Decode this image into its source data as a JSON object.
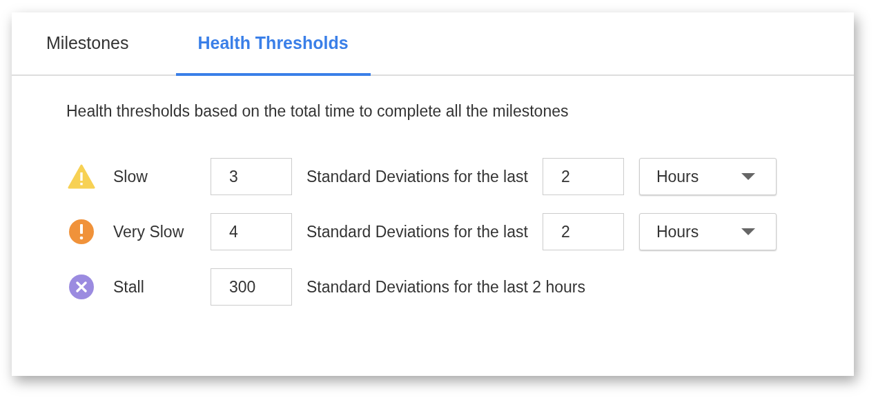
{
  "tabs": [
    {
      "label": "Milestones",
      "selected": false
    },
    {
      "label": "Health Thresholds",
      "selected": true
    }
  ],
  "description": "Health thresholds based on the total time to complete all the milestones",
  "rows": [
    {
      "kind": "warning",
      "color": "#f7d154",
      "label": "Slow",
      "value": "3",
      "text": "Standard Deviations for the last",
      "period": "2",
      "unit": "Hours"
    },
    {
      "kind": "alert",
      "color": "#f0923a",
      "label": "Very Slow",
      "value": "4",
      "text": "Standard Deviations for the last",
      "period": "2",
      "unit": "Hours"
    },
    {
      "kind": "stall",
      "color": "#9b8be0",
      "label": "Stall",
      "value": "300",
      "text": "Standard Deviations for the last 2 hours"
    }
  ]
}
